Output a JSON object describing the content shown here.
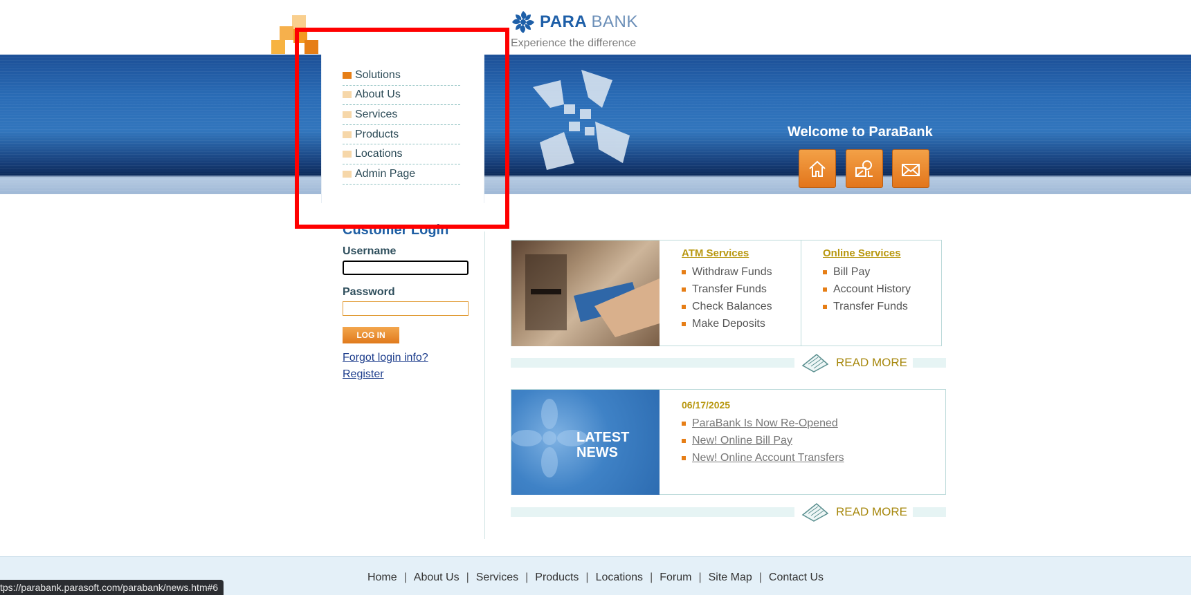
{
  "header": {
    "brand_first": "PARA",
    "brand_second": "BANK",
    "caption": "Experience the difference",
    "welcome": "Welcome to ParaBank",
    "icons": [
      "home-icon",
      "about-icon",
      "contact-icon"
    ],
    "brand_color": "#1e5fa8",
    "accent_color": "#e67e16"
  },
  "menu": {
    "items": [
      {
        "label": "Solutions",
        "active": true
      },
      {
        "label": "About Us"
      },
      {
        "label": "Services"
      },
      {
        "label": "Products"
      },
      {
        "label": "Locations"
      },
      {
        "label": "Admin Page"
      }
    ]
  },
  "login": {
    "title": "Customer Login",
    "username_label": "Username",
    "username_value": "",
    "password_label": "Password",
    "password_value": "",
    "button": "LOG IN",
    "forgot": "Forgot login info?",
    "register": "Register"
  },
  "services": {
    "atm_title": "ATM Services",
    "atm_items": [
      "Withdraw Funds",
      "Transfer Funds",
      "Check Balances",
      "Make Deposits"
    ],
    "online_title": "Online Services",
    "online_items": [
      "Bill Pay",
      "Account History",
      "Transfer Funds"
    ],
    "read_more": "READ MORE"
  },
  "news": {
    "image_text_line1": "LATEST",
    "image_text_line2": "NEWS",
    "date": "06/17/2025",
    "items": [
      "ParaBank Is Now Re-Opened",
      "New! Online Bill Pay",
      "New! Online Account Transfers"
    ],
    "read_more": "READ MORE"
  },
  "footer": {
    "links": [
      "Home",
      "About Us",
      "Services",
      "Products",
      "Locations",
      "Forum",
      "Site Map",
      "Contact Us"
    ]
  },
  "status_url": "tps://parabank.parasoft.com/parabank/news.htm#6"
}
